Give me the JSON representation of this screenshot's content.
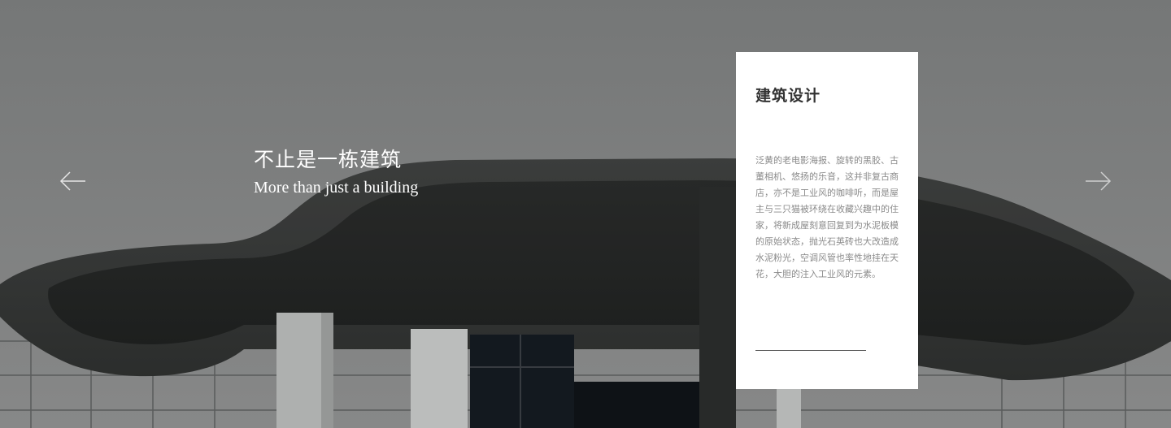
{
  "slide": {
    "title_cn": "不止是一栋建筑",
    "title_en": "More than just a building"
  },
  "card": {
    "title": "建筑设计",
    "body": "泛黄的老电影海报、旋转的黑胶、古董相机、悠扬的乐音，这并非复古商店，亦不是工业风的咖啡听，而是屋主与三只猫被环绕在收藏兴趣中的住家，将新成屋刻意回复到为水泥板模的原始状态，抛光石英砖也大改造成水泥粉光，空调风管也率性地挂在天花，大胆的注入工业风的元素。"
  },
  "nav": {
    "prev_icon": "arrow-left-icon",
    "next_icon": "arrow-right-icon"
  },
  "colors": {
    "card_bg": "#ffffff",
    "caption_text": "#ffffff",
    "card_body_text": "#8a8a8a"
  }
}
